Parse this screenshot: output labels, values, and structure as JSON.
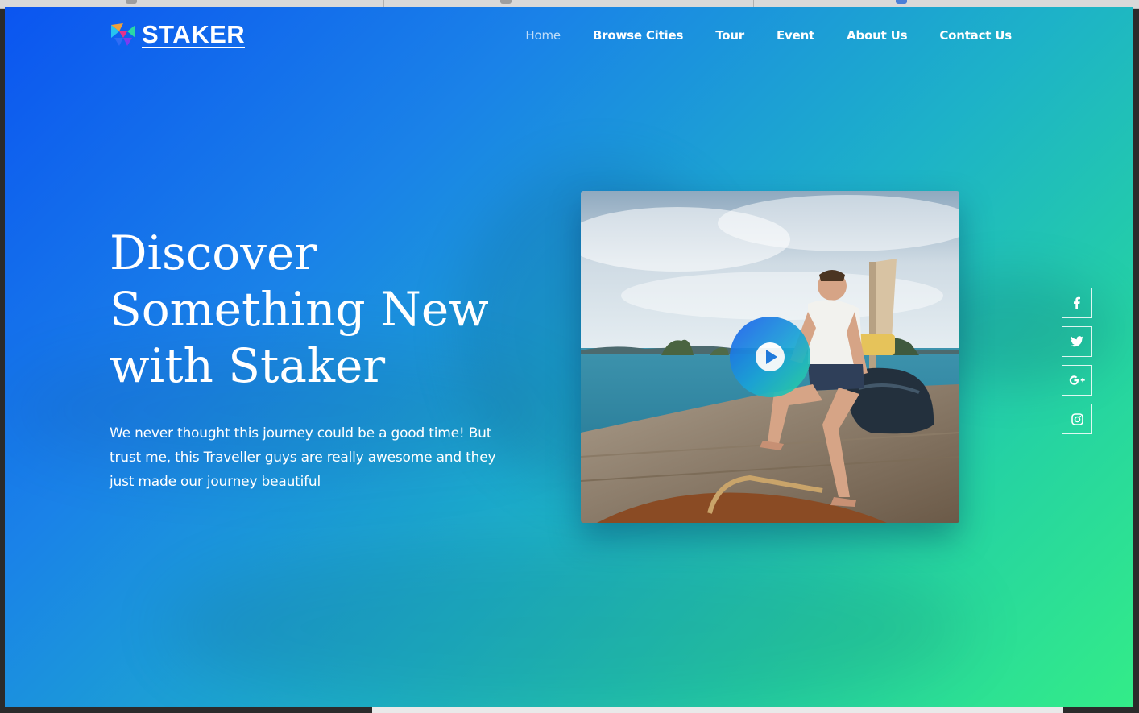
{
  "brand": {
    "name": "STAKER"
  },
  "nav": {
    "items": [
      {
        "label": "Home",
        "active": true
      },
      {
        "label": "Browse Cities",
        "active": false
      },
      {
        "label": "Tour",
        "active": false
      },
      {
        "label": "Event",
        "active": false
      },
      {
        "label": "About Us",
        "active": false
      },
      {
        "label": "Contact Us",
        "active": false
      }
    ]
  },
  "hero": {
    "title_line1": "Discover",
    "title_line2": "Something New",
    "title_line3": "with Staker",
    "description": "We never thought this journey could be a good time! But trust me, this Traveller guys are really awesome and they just made our journey beautiful"
  },
  "video": {
    "icon": "play-icon"
  },
  "social": {
    "items": [
      {
        "icon": "facebook-icon",
        "glyph": "f"
      },
      {
        "icon": "twitter-icon",
        "glyph": "t"
      },
      {
        "icon": "google-plus-icon",
        "glyph": "G+"
      },
      {
        "icon": "instagram-icon",
        "glyph": "ig"
      }
    ]
  },
  "colors": {
    "gradient_start": "#0b55f0",
    "gradient_end": "#33ec88",
    "text": "#ffffff"
  }
}
